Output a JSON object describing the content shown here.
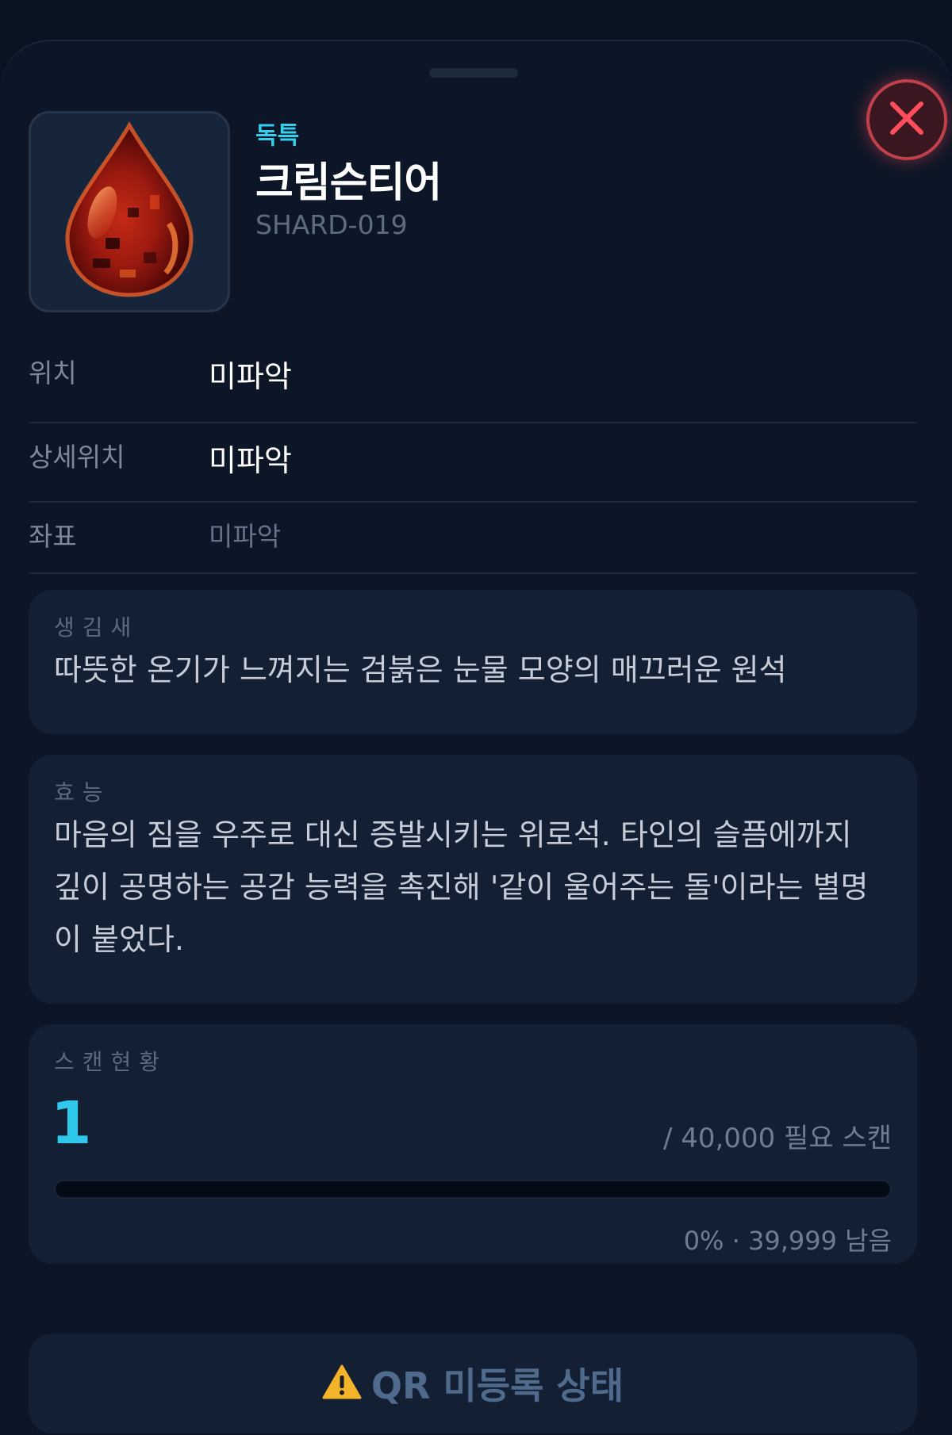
{
  "item": {
    "rarity": "독특",
    "name": "크림슨티어",
    "code": "SHARD-019",
    "image_icon": "red-teardrop-gem-icon"
  },
  "close_icon": "close-x-icon",
  "info_rows": [
    {
      "label": "위치",
      "value": "미파악"
    },
    {
      "label": "상세위치",
      "value": "미파악"
    },
    {
      "label": "좌표",
      "value": "미파악"
    }
  ],
  "appearance": {
    "label": "생김새",
    "text": "따뜻한 온기가 느껴지는 검붉은 눈물 모양의 매끄러운 원석"
  },
  "effect": {
    "label": "효능",
    "text": "마음의 짐을 우주로 대신 증발시키는 위로석. 타인의 슬픔에까지 깊이 공명하는 공감 능력을 촉진해 '같이 울어주는 돌'이라는 별명이 붙었다."
  },
  "scan": {
    "label": "스캔현황",
    "count": "1",
    "required": "/ 40,000 필요 스캔",
    "progress_fraction": 0.0,
    "remaining": "0% · 39,999 남음"
  },
  "qr": {
    "icon": "warning-icon",
    "status": "QR 미등록 상태"
  },
  "colors": {
    "accent": "#2fc8ea",
    "close": "#c0404c",
    "background": "#0d1626",
    "card": "#132034"
  }
}
